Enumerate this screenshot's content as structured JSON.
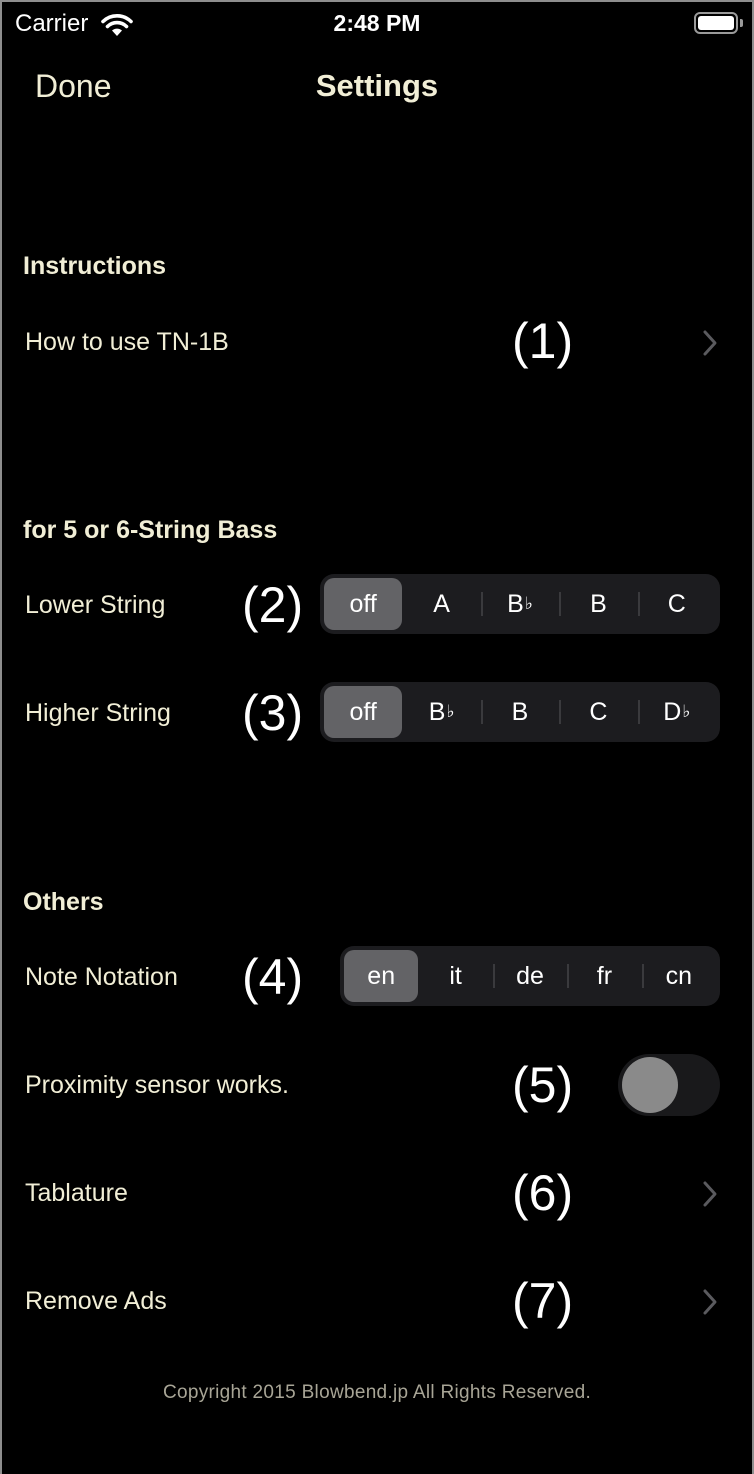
{
  "status_bar": {
    "carrier": "Carrier",
    "time": "2:48 PM",
    "wifi_icon": "wifi-icon",
    "battery_icon": "battery-icon"
  },
  "nav": {
    "done_label": "Done",
    "title": "Settings"
  },
  "sections": {
    "instructions": {
      "header": "Instructions",
      "rows": [
        {
          "label": "How to use TN-1B",
          "marker": "(1)",
          "accessory": "chevron-right-icon"
        }
      ]
    },
    "bass": {
      "header": "for 5 or 6-String Bass",
      "lower": {
        "label": "Lower String",
        "marker": "(2)",
        "options": [
          {
            "base": "off",
            "flat": ""
          },
          {
            "base": "A",
            "flat": ""
          },
          {
            "base": "B",
            "flat": "♭"
          },
          {
            "base": "B",
            "flat": ""
          },
          {
            "base": "C",
            "flat": ""
          }
        ],
        "selected": "off"
      },
      "higher": {
        "label": "Higher String",
        "marker": "(3)",
        "options": [
          {
            "base": "off",
            "flat": ""
          },
          {
            "base": "B",
            "flat": "♭"
          },
          {
            "base": "B",
            "flat": ""
          },
          {
            "base": "C",
            "flat": ""
          },
          {
            "base": "D",
            "flat": "♭"
          }
        ],
        "selected": "off"
      }
    },
    "others": {
      "header": "Others",
      "notation": {
        "label": "Note Notation",
        "marker": "(4)",
        "options": [
          "en",
          "it",
          "de",
          "fr",
          "cn"
        ],
        "selected": "en"
      },
      "proximity": {
        "label": "Proximity sensor works.",
        "marker": "(5)",
        "enabled": false
      },
      "tablature": {
        "label": "Tablature",
        "marker": "(6)",
        "accessory": "chevron-right-icon"
      },
      "remove_ads": {
        "label": "Remove Ads",
        "marker": "(7)",
        "accessory": "chevron-right-icon"
      }
    }
  },
  "footer": {
    "copyright": "Copyright 2015 Blowbend.jp All Rights Reserved."
  },
  "colors": {
    "background": "#000000",
    "text": "#f1eed6",
    "segment_bg": "#1c1c1f",
    "segment_selected": "#636366",
    "toggle_knob": "#8a8a8a",
    "chevron": "#5a5a5e"
  }
}
